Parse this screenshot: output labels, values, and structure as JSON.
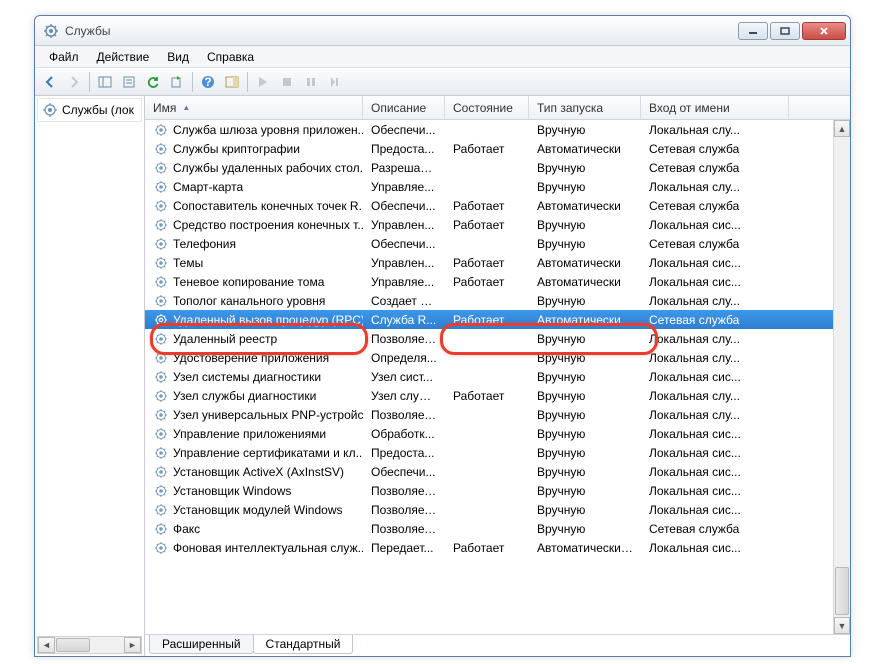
{
  "window": {
    "title": "Службы"
  },
  "menu": {
    "file": "Файл",
    "action": "Действие",
    "view": "Вид",
    "help": "Справка"
  },
  "tree": {
    "root": "Службы (лок"
  },
  "columns": {
    "name": "Имя",
    "description": "Описание",
    "status": "Состояние",
    "startup": "Тип запуска",
    "logon": "Вход от имени"
  },
  "tabs": {
    "extended": "Расширенный",
    "standard": "Стандартный"
  },
  "services": [
    {
      "name": "Служба шлюза уровня приложен...",
      "desc": "Обеспечи...",
      "state": "",
      "start": "Вручную",
      "logon": "Локальная слу..."
    },
    {
      "name": "Службы криптографии",
      "desc": "Предоста...",
      "state": "Работает",
      "start": "Автоматически",
      "logon": "Сетевая служба"
    },
    {
      "name": "Службы удаленных рабочих стол...",
      "desc": "Разрешает...",
      "state": "",
      "start": "Вручную",
      "logon": "Сетевая служба"
    },
    {
      "name": "Смарт-карта",
      "desc": "Управляе...",
      "state": "",
      "start": "Вручную",
      "logon": "Локальная слу..."
    },
    {
      "name": "Сопоставитель конечных точек R...",
      "desc": "Обеспечи...",
      "state": "Работает",
      "start": "Автоматически",
      "logon": "Сетевая служба"
    },
    {
      "name": "Средство построения конечных т...",
      "desc": "Управлен...",
      "state": "Работает",
      "start": "Вручную",
      "logon": "Локальная сис..."
    },
    {
      "name": "Телефония",
      "desc": "Обеспечи...",
      "state": "",
      "start": "Вручную",
      "logon": "Сетевая служба"
    },
    {
      "name": "Темы",
      "desc": "Управлен...",
      "state": "Работает",
      "start": "Автоматически",
      "logon": "Локальная сис..."
    },
    {
      "name": "Теневое копирование тома",
      "desc": "Управляе...",
      "state": "Работает",
      "start": "Автоматически",
      "logon": "Локальная сис..."
    },
    {
      "name": "Тополог канального уровня",
      "desc": "Создает ка...",
      "state": "",
      "start": "Вручную",
      "logon": "Локальная слу..."
    },
    {
      "name": "Удаленный вызов процедур (RPC)",
      "desc": "Служба R...",
      "state": "Работает",
      "start": "Автоматически",
      "logon": "Сетевая служба",
      "selected": true
    },
    {
      "name": "Удаленный реестр",
      "desc": "Позволяет...",
      "state": "",
      "start": "Вручную",
      "logon": "Локальная слу..."
    },
    {
      "name": "Удостоверение приложения",
      "desc": "Определя...",
      "state": "",
      "start": "Вручную",
      "logon": "Локальная слу..."
    },
    {
      "name": "Узел системы диагностики",
      "desc": "Узел сист...",
      "state": "",
      "start": "Вручную",
      "logon": "Локальная сис..."
    },
    {
      "name": "Узел службы диагностики",
      "desc": "Узел служ...",
      "state": "Работает",
      "start": "Вручную",
      "logon": "Локальная слу..."
    },
    {
      "name": "Узел универсальных PNP-устройс...",
      "desc": "Позволяет...",
      "state": "",
      "start": "Вручную",
      "logon": "Локальная слу..."
    },
    {
      "name": "Управление приложениями",
      "desc": "Обработк...",
      "state": "",
      "start": "Вручную",
      "logon": "Локальная сис..."
    },
    {
      "name": "Управление сертификатами и кл...",
      "desc": "Предоста...",
      "state": "",
      "start": "Вручную",
      "logon": "Локальная сис..."
    },
    {
      "name": "Установщик ActiveX (AxInstSV)",
      "desc": "Обеспечи...",
      "state": "",
      "start": "Вручную",
      "logon": "Локальная сис..."
    },
    {
      "name": "Установщик Windows",
      "desc": "Позволяет...",
      "state": "",
      "start": "Вручную",
      "logon": "Локальная сис..."
    },
    {
      "name": "Установщик модулей Windows",
      "desc": "Позволяет...",
      "state": "",
      "start": "Вручную",
      "logon": "Локальная сис..."
    },
    {
      "name": "Факс",
      "desc": "Позволяет...",
      "state": "",
      "start": "Вручную",
      "logon": "Сетевая служба"
    },
    {
      "name": "Фоновая интеллектуальная служ...",
      "desc": "Передает...",
      "state": "Работает",
      "start": "Автоматически (...",
      "logon": "Локальная сис..."
    }
  ]
}
